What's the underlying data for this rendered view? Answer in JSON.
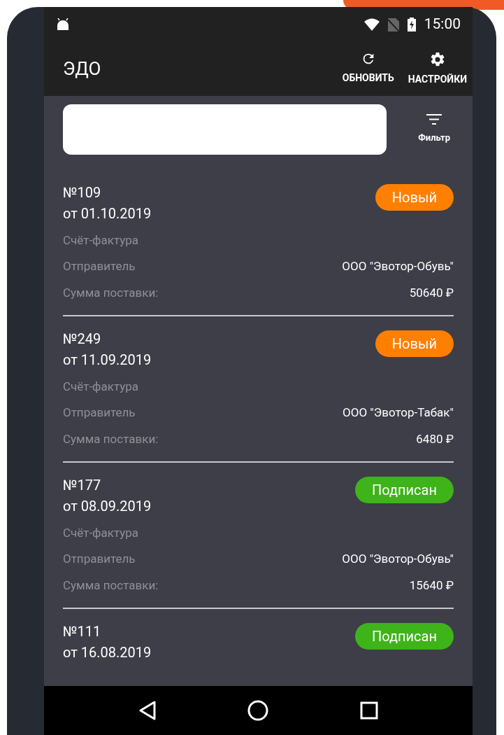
{
  "status_bar": {
    "time": "15:00"
  },
  "app_bar": {
    "title": "ЭДО",
    "actions": [
      {
        "kind": "refresh",
        "label": "ОБНОВИТЬ"
      },
      {
        "kind": "settings",
        "label": "НАСТРОЙКИ"
      }
    ]
  },
  "search": {
    "filter_label": "Фильтр"
  },
  "documents": [
    {
      "number": "№109",
      "date": "от 01.10.2019",
      "type": "Счёт-фактура",
      "sender_label": "Отправитель",
      "sender": "ООО \"Эвотор-Обувь\"",
      "sum_label": "Сумма поставки:",
      "sum": "50640 ₽",
      "status": {
        "label": "Новый",
        "color": "#ff7f00"
      }
    },
    {
      "number": "№249",
      "date": "от 11.09.2019",
      "type": "Счёт-фактура",
      "sender_label": "Отправитель",
      "sender": "ООО \"Эвотор-Табак\"",
      "sum_label": "Сумма поставки:",
      "sum": "6480 ₽",
      "status": {
        "label": "Новый",
        "color": "#ff7f00"
      }
    },
    {
      "number": "№177",
      "date": "от 08.09.2019",
      "type": "Счёт-фактура",
      "sender_label": "Отправитель",
      "sender": "ООО \"Эвотор-Обувь\"",
      "sum_label": "Сумма поставки:",
      "sum": "15640 ₽",
      "status": {
        "label": "Подписан",
        "color": "#3fb31a"
      }
    },
    {
      "number": "№111",
      "date": "от 16.08.2019",
      "status": {
        "label": "Подписан",
        "color": "#3fb31a"
      }
    }
  ]
}
